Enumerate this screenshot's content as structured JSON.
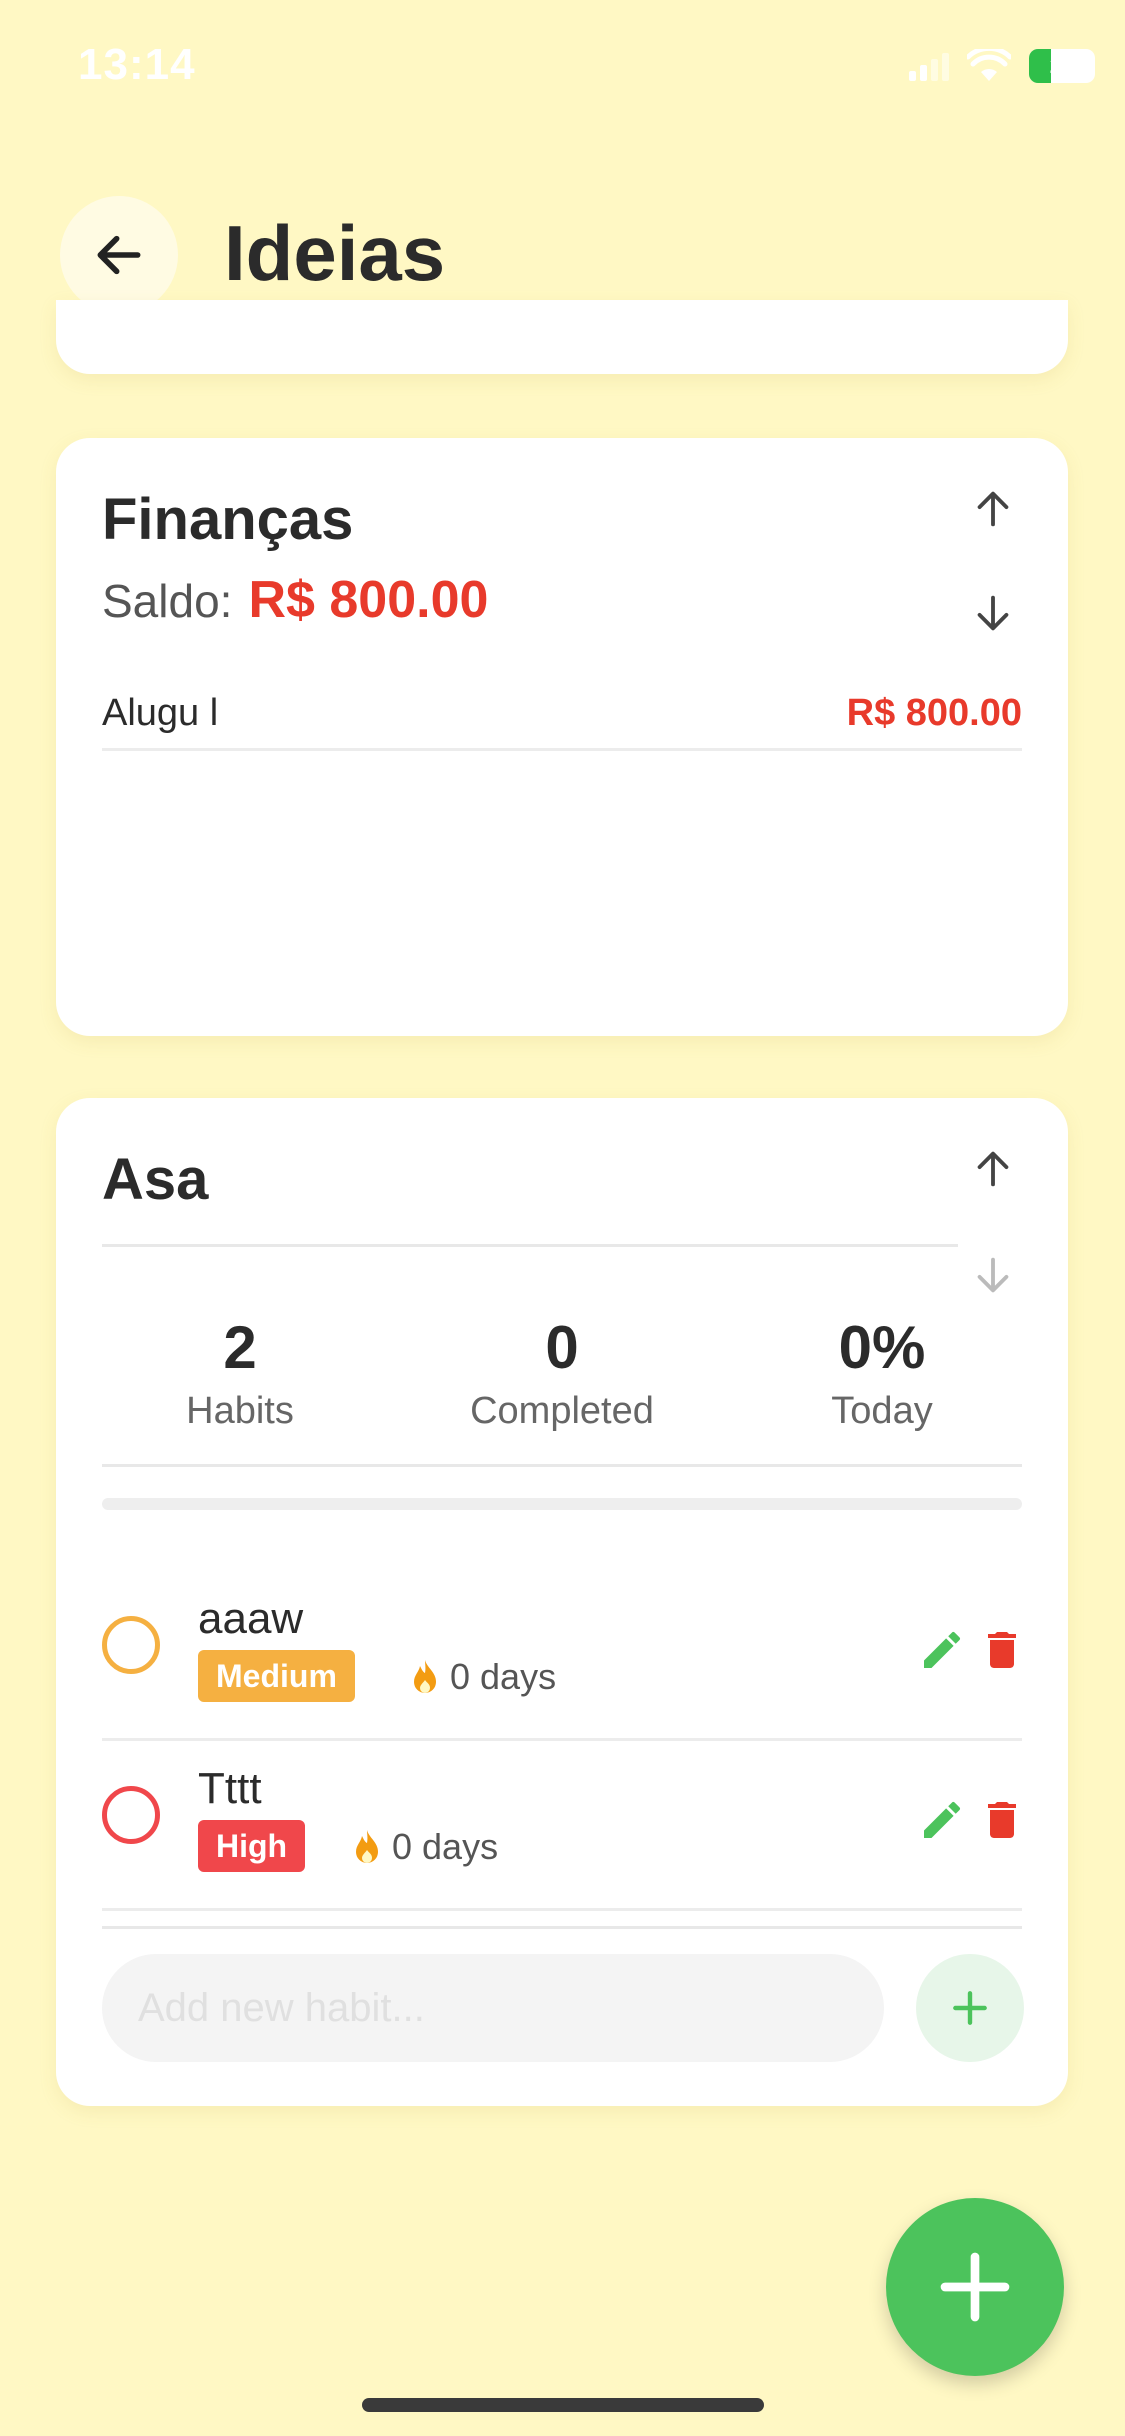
{
  "status_bar": {
    "time": "13:14",
    "battery": "29"
  },
  "header": {
    "title": "Ideias",
    "back_icon": "arrow-left-icon"
  },
  "finances_card": {
    "title": "Finanças",
    "balance_label": "Saldo:",
    "balance_value": "R$ 800.00",
    "entries": [
      {
        "name": "Alugu l",
        "amount": "R$ 800.00"
      }
    ]
  },
  "habits_card": {
    "title": "Asa",
    "stats": [
      {
        "value": "2",
        "label": "Habits"
      },
      {
        "value": "0",
        "label": "Completed"
      },
      {
        "value": "0%",
        "label": "Today"
      }
    ],
    "progress": 0,
    "habits": [
      {
        "name": "aaaw",
        "priority": "Medium",
        "streak": "0 days",
        "color": "#f5b041"
      },
      {
        "name": "Tttt",
        "priority": "High",
        "streak": "0 days",
        "color": "#f0474b"
      }
    ],
    "add_placeholder": "Add new habit..."
  },
  "colors": {
    "background": "#fff8c4",
    "accent_green": "#4cc35c",
    "money_red": "#e83a2b",
    "medium": "#f5b041",
    "high": "#f0474b"
  }
}
